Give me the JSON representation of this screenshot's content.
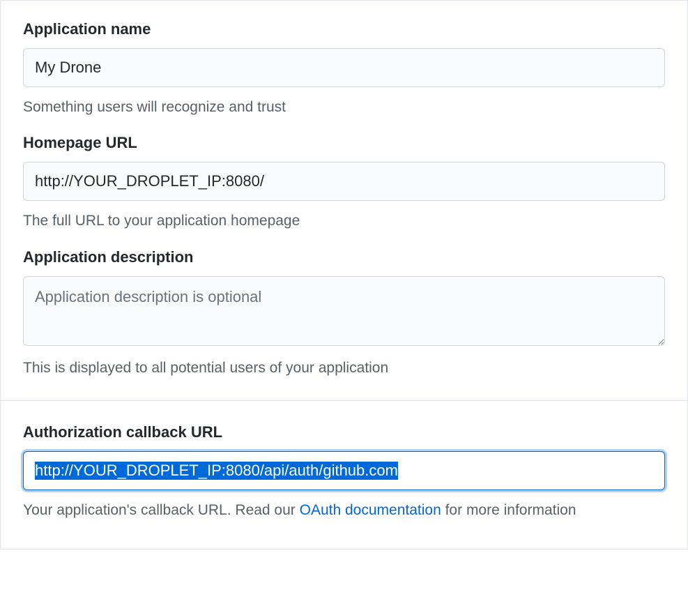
{
  "app_name": {
    "label": "Application name",
    "value": "My Drone",
    "help": "Something users will recognize and trust"
  },
  "homepage_url": {
    "label": "Homepage URL",
    "value": "http://YOUR_DROPLET_IP:8080/",
    "help": "The full URL to your application homepage"
  },
  "app_description": {
    "label": "Application description",
    "placeholder": "Application description is optional",
    "help": "This is displayed to all potential users of your application"
  },
  "callback_url": {
    "label": "Authorization callback URL",
    "value": "http://YOUR_DROPLET_IP:8080/api/auth/github.com",
    "help_prefix": "Your application's callback URL. Read our ",
    "help_link_text": "OAuth documentation",
    "help_suffix": " for more information"
  }
}
